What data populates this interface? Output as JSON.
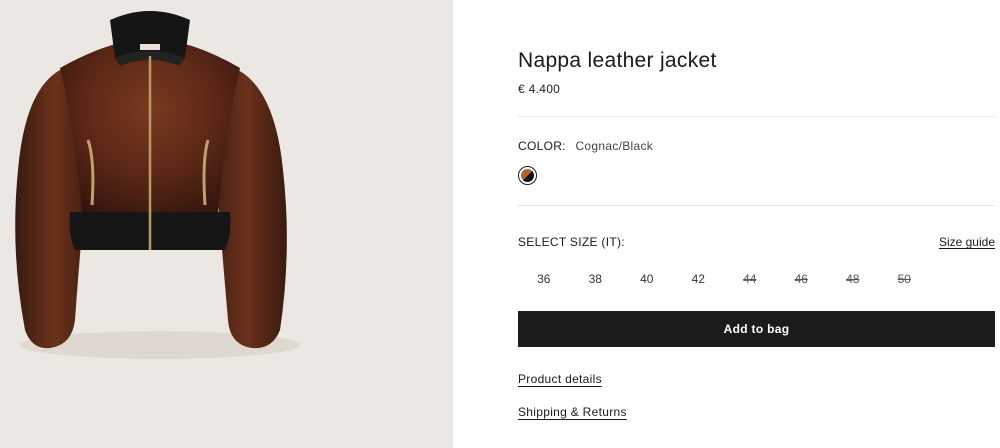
{
  "product": {
    "title": "Nappa leather jacket",
    "price": "€ 4.400",
    "image_alt": "Nappa leather jacket"
  },
  "color": {
    "label": "COLOR:",
    "value": "Cognac/Black",
    "swatch_colors": [
      "#b8622f",
      "#111111"
    ]
  },
  "size": {
    "label": "SELECT SIZE (IT):",
    "guide_label": "Size guide",
    "options": [
      {
        "label": "36",
        "available": true
      },
      {
        "label": "38",
        "available": true
      },
      {
        "label": "40",
        "available": true
      },
      {
        "label": "42",
        "available": true
      },
      {
        "label": "44",
        "available": false
      },
      {
        "label": "46",
        "available": false
      },
      {
        "label": "48",
        "available": false
      },
      {
        "label": "50",
        "available": false
      }
    ]
  },
  "actions": {
    "add_to_bag": "Add to bag"
  },
  "links": {
    "product_details": "Product details",
    "shipping_returns": "Shipping & Returns"
  },
  "colors": {
    "gallery_bg": "#ebe7e2",
    "button_bg": "#1c1c1c",
    "leather": "#5a2a1a"
  }
}
